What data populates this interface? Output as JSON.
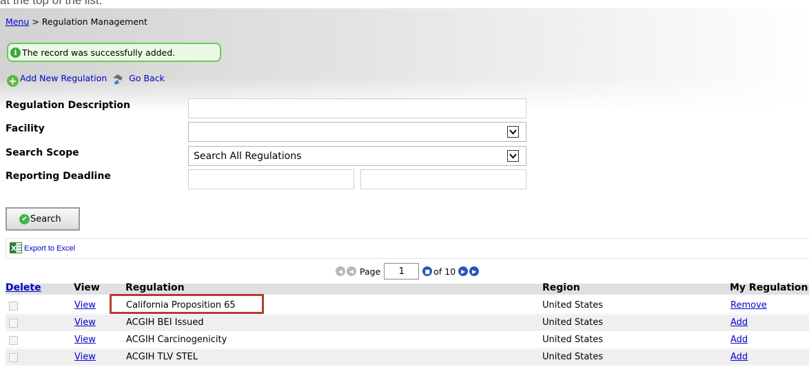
{
  "caption": "at the top of the list.",
  "breadcrumb": {
    "menu": "Menu",
    "separator": ">",
    "current": "Regulation Management"
  },
  "success_message": "The record was successfully added.",
  "actions": {
    "add_new": "Add New Regulation",
    "go_back": "Go Back"
  },
  "form": {
    "description_label": "Regulation Description",
    "description_value": "",
    "facility_label": "Facility",
    "facility_value": "",
    "scope_label": "Search Scope",
    "scope_value": "Search All Regulations",
    "deadline_label": "Reporting Deadline",
    "deadline_from": "",
    "deadline_to": ""
  },
  "search_button": "Search",
  "export_excel": "Export to Excel",
  "pager": {
    "page_label": "Page",
    "page_value": "1",
    "of_label": "of 10"
  },
  "grid": {
    "headers": {
      "delete": "Delete",
      "view": "View",
      "regulation": "Regulation",
      "region": "Region",
      "my_regulation": "My Regulation"
    },
    "rows": [
      {
        "view": "View",
        "regulation": "California Proposition 65",
        "region": "United States",
        "action": "Remove",
        "highlighted": true
      },
      {
        "view": "View",
        "regulation": "ACGIH BEI Issued",
        "region": "United States",
        "action": "Add"
      },
      {
        "view": "View",
        "regulation": "ACGIH Carcinogenicity",
        "region": "United States",
        "action": "Add"
      },
      {
        "view": "View",
        "regulation": "ACGIH TLV STEL",
        "region": "United States",
        "action": "Add"
      }
    ]
  },
  "colors": {
    "link": "#0000cc",
    "success_border": "#5fd04f",
    "highlight_border": "#b13f2f",
    "header_bg": "#e0e0e0",
    "alt_row_bg": "#efefef"
  },
  "icons": {
    "info": "info-icon",
    "add": "plus-circle-icon",
    "back": "go-back-icon",
    "search": "check-circle-icon",
    "excel": "excel-icon",
    "first": "first-page-icon",
    "prev": "prev-page-icon",
    "next": "next-page-icon",
    "last": "last-page-icon"
  }
}
